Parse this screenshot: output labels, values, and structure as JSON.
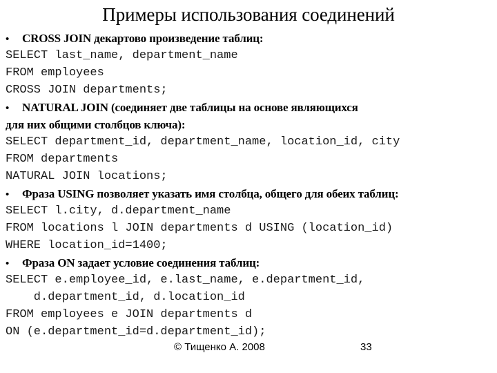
{
  "slide": {
    "title": "Примеры использования соединений",
    "bullet_glyph": "•",
    "lines": [
      {
        "type": "bullet",
        "text": "CROSS JOIN декартово произведение таблиц:"
      },
      {
        "type": "code",
        "text": "SELECT last_name, department_name"
      },
      {
        "type": "code",
        "text": "FROM employees"
      },
      {
        "type": "code",
        "text": "CROSS JOIN departments;"
      },
      {
        "type": "bullet",
        "text": "NATURAL JOIN (соединяет две таблицы на основе являющихся"
      },
      {
        "type": "cont",
        "text": "для них общими столбцов ключа):"
      },
      {
        "type": "code",
        "text": "SELECT department_id, department_name, location_id, city"
      },
      {
        "type": "code",
        "text": "FROM departments"
      },
      {
        "type": "code",
        "text": "NATURAL JOIN locations;"
      },
      {
        "type": "bullet",
        "text": "Фраза USING позволяет указать имя столбца, общего для обеих таблиц:"
      },
      {
        "type": "code",
        "text": "SELECT l.city, d.department_name"
      },
      {
        "type": "code",
        "text": "FROM locations l JOIN departments d USING (location_id)"
      },
      {
        "type": "code",
        "text": "WHERE location_id=1400;"
      },
      {
        "type": "bullet",
        "text": "Фраза ON задает условие соединения таблиц:"
      },
      {
        "type": "code",
        "text": "SELECT e.employee_id, e.last_name, e.department_id,"
      },
      {
        "type": "code",
        "text": "    d.department_id, d.location_id"
      },
      {
        "type": "code",
        "text": "FROM employees e JOIN departments d"
      },
      {
        "type": "code",
        "text": "ON (e.department_id=d.department_id);"
      }
    ]
  },
  "footer": {
    "copyright": "© Тищенко А. 2008",
    "page_number": "33"
  }
}
